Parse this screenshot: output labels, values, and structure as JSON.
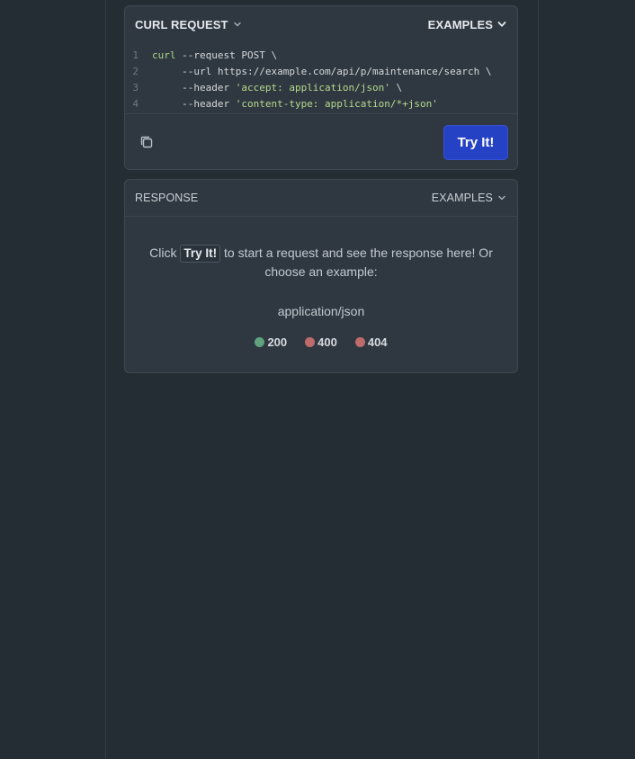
{
  "request": {
    "title": "CURL REQUEST",
    "examples_label": "EXAMPLES",
    "code_lines": [
      {
        "num": "1",
        "cmd": "curl",
        "flag": " --request",
        "rest": " POST \\",
        "str": "",
        "tail": ""
      },
      {
        "num": "2",
        "cmd": "",
        "flag": "     --url",
        "rest": " https://example.com/api/p/maintenance/search \\",
        "str": "",
        "tail": ""
      },
      {
        "num": "3",
        "cmd": "",
        "flag": "     --header",
        "rest": " ",
        "str": "'accept: application/json'",
        "tail": " \\"
      },
      {
        "num": "4",
        "cmd": "",
        "flag": "     --header",
        "rest": " ",
        "str": "'content-type: application/*+json'",
        "tail": ""
      }
    ],
    "try_label": "Try It!"
  },
  "response": {
    "title": "RESPONSE",
    "examples_label": "EXAMPLES",
    "message_before": "Click ",
    "message_kbd": "Try It!",
    "message_after": " to start a request and see the response here! Or choose an example:",
    "media_type": "application/json",
    "status_codes": [
      {
        "code": "200",
        "color": "#5fa27c"
      },
      {
        "code": "400",
        "color": "#c06b6b"
      },
      {
        "code": "404",
        "color": "#c06b6b"
      }
    ]
  },
  "colors": {
    "accent": "#2642c4",
    "success": "#5fa27c",
    "error": "#c06b6b"
  }
}
